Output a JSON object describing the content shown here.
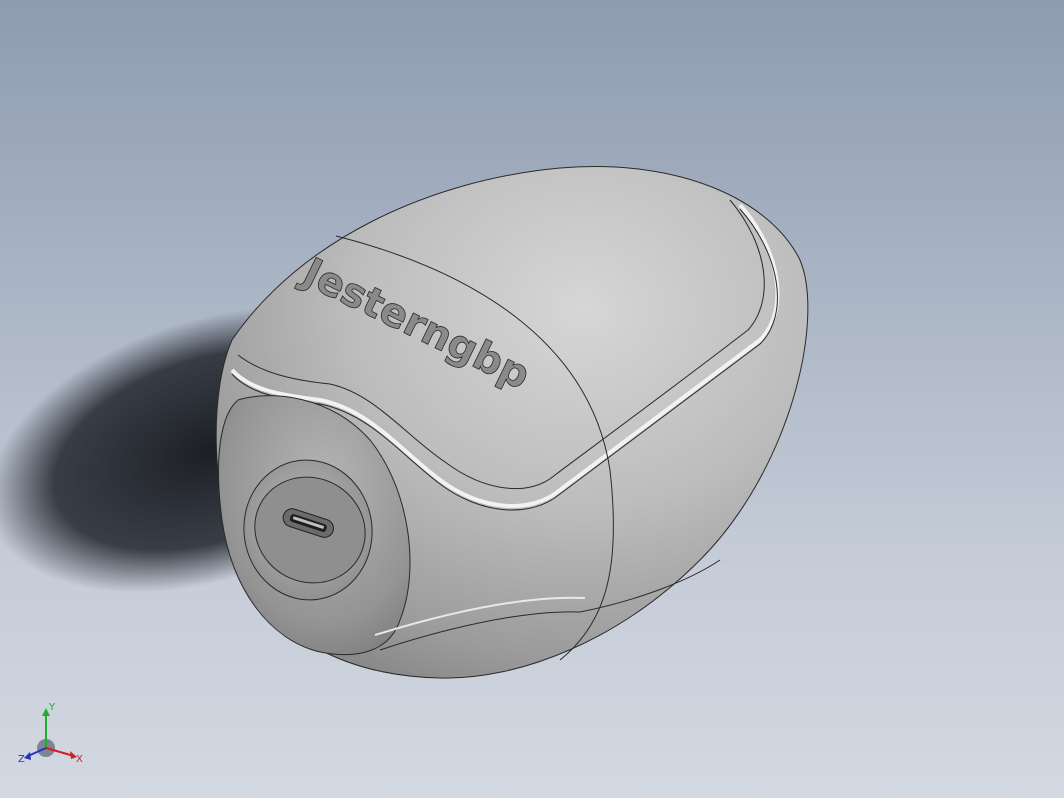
{
  "model": {
    "embossed_text": "Jesterngbp",
    "body_color": "#b9b9b9",
    "shadow_color": "#1e2127",
    "edge_color": "#2a2a2a"
  },
  "triad": {
    "x_label": "X",
    "y_label": "Y",
    "z_label": "Z",
    "x_color": "#d11f1f",
    "y_color": "#1fae2a",
    "z_color": "#2233c4"
  }
}
